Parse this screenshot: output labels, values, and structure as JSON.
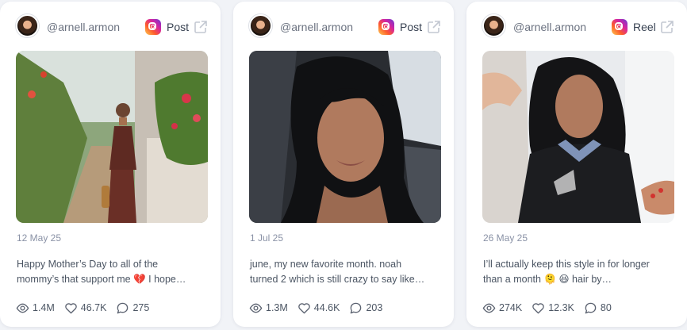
{
  "cards": [
    {
      "handle": "@arnell.armon",
      "type": "Post",
      "date": "12 May 25",
      "caption_line1": "Happy Mother’s Day to all of the",
      "caption_line2_a": "mommy’s that support me",
      "caption_emoji": "💔",
      "caption_line2_b": "I hope…",
      "views": "1.4M",
      "likes": "46.7K",
      "comments": "275"
    },
    {
      "handle": "@arnell.armon",
      "type": "Post",
      "date": "1 Jul 25",
      "caption_line1": "june, my new favorite month. noah",
      "caption_line2_a": "turned 2 which is still crazy to say like…",
      "caption_emoji": "",
      "caption_line2_b": "",
      "views": "1.3M",
      "likes": "44.6K",
      "comments": "203"
    },
    {
      "handle": "@arnell.armon",
      "type": "Reel",
      "date": "26 May 25",
      "caption_line1": "I’ll actually keep this style in for longer",
      "caption_line2_a": "than a month",
      "caption_emoji": "🫠 😆",
      "caption_line2_b": "hair by…",
      "views": "274K",
      "likes": "12.3K",
      "comments": "80"
    }
  ],
  "icons": {
    "platform": "instagram-icon",
    "open": "external-link-icon",
    "views": "eye-icon",
    "likes": "heart-icon",
    "comments": "comment-icon"
  },
  "colors": {
    "background": "#f1f3f7",
    "card": "#ffffff",
    "muted_text": "#8a92a6",
    "body_text": "#4b5563"
  }
}
